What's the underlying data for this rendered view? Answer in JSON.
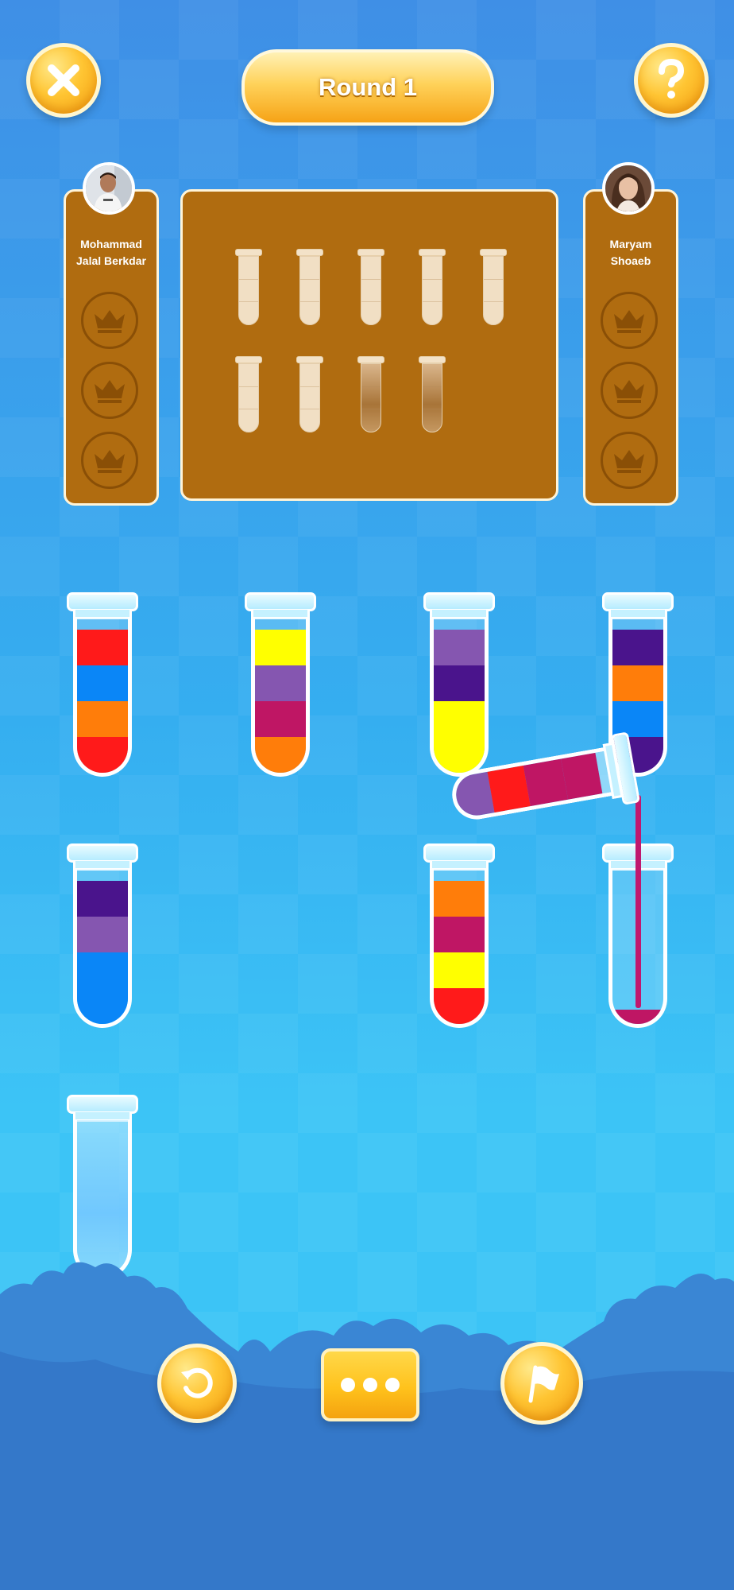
{
  "header": {
    "round_label": "Round 1",
    "close_icon": "close-icon",
    "help_icon": "question-mark-icon"
  },
  "players": [
    {
      "name_line1": "Mohammad",
      "name_line2": "Jalal Berkdar",
      "crowns_won": 0,
      "crown_slots": 3
    },
    {
      "name_line1": "Maryam",
      "name_line2": "Shoaeb",
      "crowns_won": 0,
      "crown_slots": 3
    }
  ],
  "opponent_board": {
    "tubes": [
      "clean",
      "clean",
      "clean",
      "clean",
      "clean",
      "clean",
      "clean",
      "dirty",
      "dirty"
    ]
  },
  "colors": {
    "red": "#ff1a1a",
    "blue": "#0a86f7",
    "orange": "#ff7d0a",
    "yellow": "#ffff00",
    "purple": "#8556b0",
    "magenta": "#bf1664",
    "dark_purple": "#4a148c"
  },
  "tubes": [
    {
      "id": 1,
      "layers_top_to_bottom": [
        "red",
        "blue",
        "orange",
        "red"
      ]
    },
    {
      "id": 2,
      "layers_top_to_bottom": [
        "yellow",
        "purple",
        "magenta",
        "orange"
      ]
    },
    {
      "id": 3,
      "layers_top_to_bottom": [
        "purple",
        "dark_purple",
        "yellow",
        "yellow"
      ]
    },
    {
      "id": 4,
      "layers_top_to_bottom": [
        "dark_purple",
        "orange",
        "blue",
        "dark_purple"
      ]
    },
    {
      "id": 5,
      "layers_top_to_bottom": [
        "dark_purple",
        "purple",
        "blue",
        "blue"
      ]
    },
    {
      "id": 6,
      "layers_top_to_bottom": [
        "orange",
        "magenta",
        "yellow",
        "red"
      ]
    },
    {
      "id": 7,
      "layers_top_to_bottom": [],
      "receiving": "magenta"
    },
    {
      "id": 8,
      "layers_top_to_bottom": []
    }
  ],
  "pouring_tube": {
    "layers_mouth_to_bottom": [
      "magenta",
      "magenta",
      "red",
      "purple"
    ]
  },
  "footer": {
    "undo_icon": "undo-icon",
    "more_icon": "more-dots-icon",
    "flag_icon": "surrender-flag-icon"
  }
}
